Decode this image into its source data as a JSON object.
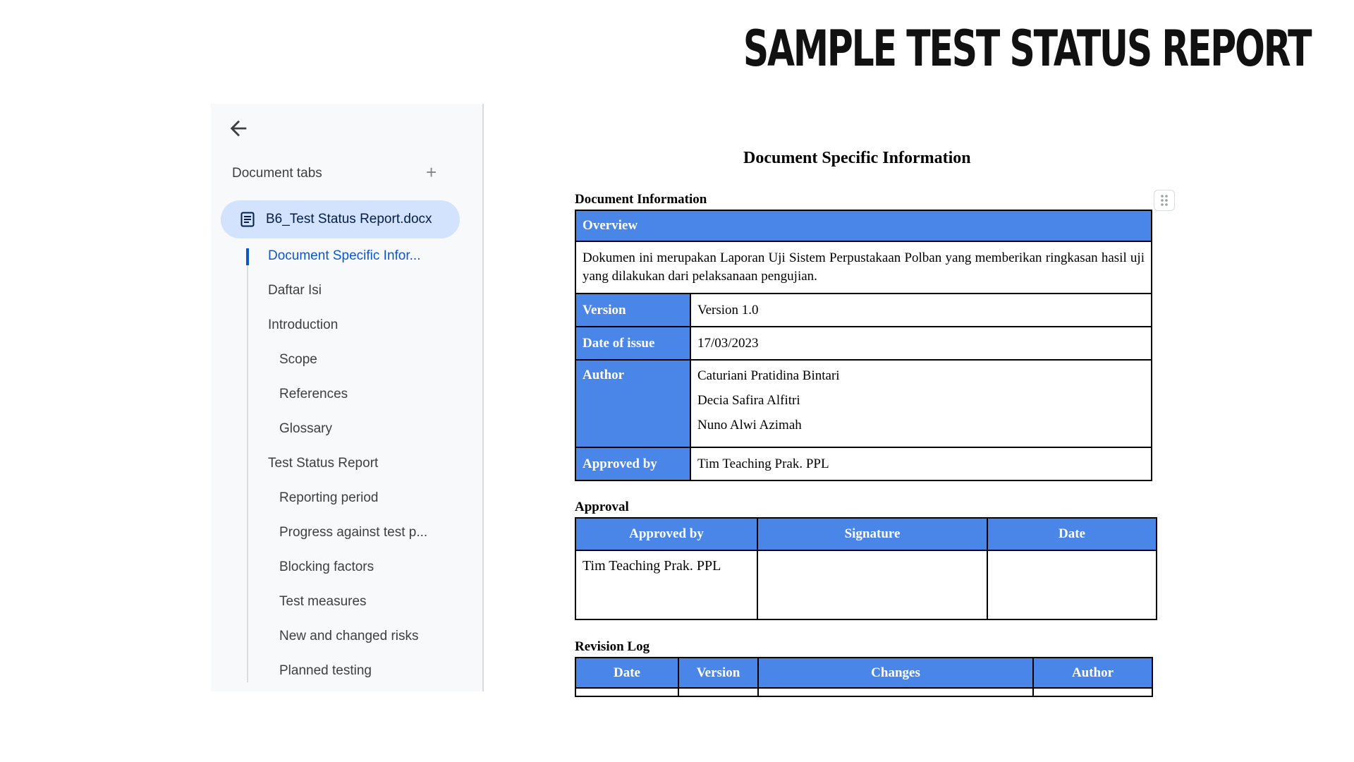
{
  "slide_title": "SAMPLE TEST STATUS REPORT",
  "sidebar": {
    "tabs_header": "Document tabs",
    "add_tab_icon": "plus-icon",
    "back_icon": "arrow-left-icon",
    "document_tab": {
      "icon": "document-icon",
      "label": "B6_Test Status Report.docx"
    },
    "outline": [
      {
        "label": "Document Specific Infor...",
        "level": 1,
        "active": true
      },
      {
        "label": "Daftar Isi",
        "level": 1
      },
      {
        "label": "Introduction",
        "level": 1
      },
      {
        "label": "Scope",
        "level": 2
      },
      {
        "label": "References",
        "level": 2
      },
      {
        "label": "Glossary",
        "level": 2
      },
      {
        "label": "Test Status Report",
        "level": 1
      },
      {
        "label": "Reporting period",
        "level": 2
      },
      {
        "label": "Progress against test p...",
        "level": 2
      },
      {
        "label": "Blocking factors",
        "level": 2
      },
      {
        "label": "Test measures",
        "level": 2
      },
      {
        "label": "New and changed risks",
        "level": 2
      },
      {
        "label": "Planned testing",
        "level": 2
      }
    ]
  },
  "document": {
    "heading": "Document Specific Information",
    "info_section": {
      "label": "Document Information",
      "overview_header": "Overview",
      "overview_text": "Dokumen ini merupakan Laporan Uji Sistem Perpustakaan Polban yang memberikan ringkasan hasil uji yang dilakukan dari pelaksanaan pengujian.",
      "rows": {
        "version_label": "Version",
        "version_value": "Version 1.0",
        "date_label": "Date of issue",
        "date_value": "17/03/2023",
        "author_label": "Author",
        "authors": [
          "Caturiani Pratidina Bintari",
          "Decia Safira Alfitri",
          "Nuno Alwi Azimah"
        ],
        "approved_label": "Approved by",
        "approved_value": "Tim Teaching Prak. PPL"
      }
    },
    "approval_section": {
      "label": "Approval",
      "headers": [
        "Approved by",
        "Signature",
        "Date"
      ],
      "row": [
        "Tim Teaching Prak. PPL",
        "",
        ""
      ]
    },
    "revision_section": {
      "label": "Revision Log",
      "headers": [
        "Date",
        "Version",
        "Changes",
        "Author"
      ]
    }
  },
  "colors": {
    "table_header": "#4a86e8",
    "active_outline": "#0b57d0",
    "active_tab_bg": "#d3e3fd"
  }
}
